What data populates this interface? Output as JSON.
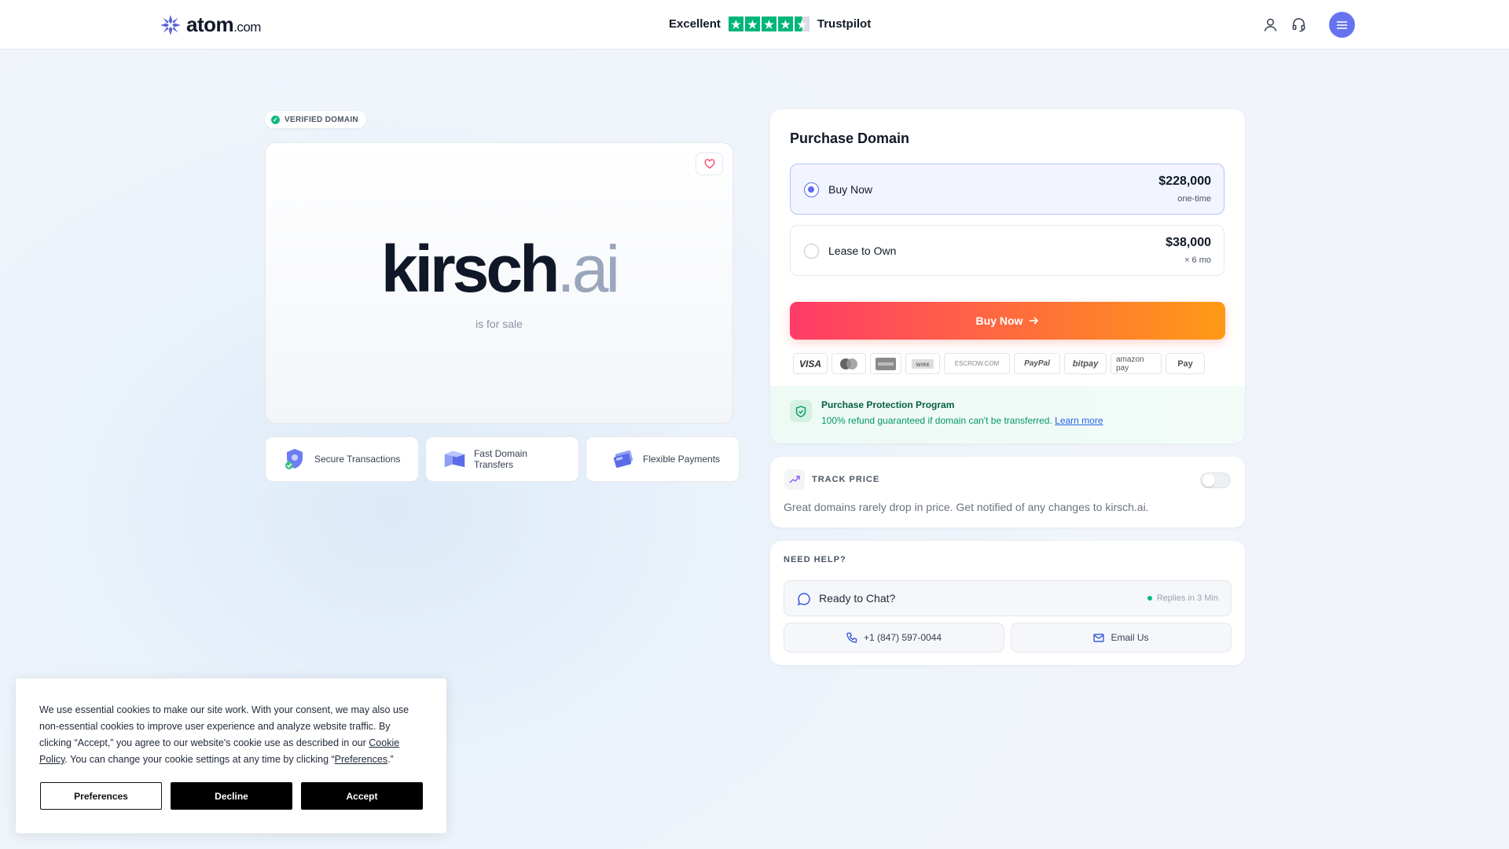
{
  "header": {
    "logo_text": "atom",
    "logo_suffix": ".com",
    "trust_label": "Excellent",
    "trust_brand": "Trustpilot",
    "trust_rating_stars": 4.5,
    "trust_color": "#00b67a",
    "menu_color": "#6673f0"
  },
  "domain": {
    "badge": "VERIFIED DOMAIN",
    "name": "kirsch",
    "tld": ".ai",
    "subtitle": "is for sale"
  },
  "features": [
    {
      "label": "Secure Transactions",
      "icon": "shield-icon"
    },
    {
      "label": "Fast Domain Transfers",
      "icon": "transfer-icon"
    },
    {
      "label": "Flexible Payments",
      "icon": "card-icon"
    }
  ],
  "purchase": {
    "title": "Purchase Domain",
    "options": [
      {
        "label": "Buy Now",
        "price": "$228,000",
        "sub": "one-time",
        "selected": true
      },
      {
        "label": "Lease to Own",
        "price": "$38,000",
        "sub": "× 6 mo",
        "selected": false
      }
    ],
    "buy_button": "Buy Now",
    "payment_methods": [
      "VISA",
      "mastercard",
      "AMEX",
      "WIRE",
      "ESCROW.COM",
      "PayPal",
      "bitpay",
      "amazon pay",
      "Pay"
    ],
    "protection": {
      "title": "Purchase Protection Program",
      "text": "100% refund guaranteed if domain can't be transferred.",
      "link": "Learn more"
    }
  },
  "track": {
    "title": "TRACK PRICE",
    "description": "Great domains rarely drop in price. Get notified of any changes to kirsch.ai.",
    "enabled": false
  },
  "help": {
    "title": "NEED HELP?",
    "chat_label": "Ready to Chat?",
    "chat_status": "Replies in 3 Min",
    "phone": "+1 (847) 597-0044",
    "email": "Email Us"
  },
  "cookie": {
    "text_1": "We use essential cookies to make our site work. With your consent, we may also use non-essential cookies to improve user experience and analyze website traffic. By clicking “Accept,” you agree to our website's cookie use as described in our ",
    "link_policy": "Cookie Policy",
    "text_2": ". You can change your cookie settings at any time by clicking “",
    "link_prefs": "Preferences",
    "text_3": ".”",
    "btn_preferences": "Preferences",
    "btn_decline": "Decline",
    "btn_accept": "Accept"
  }
}
